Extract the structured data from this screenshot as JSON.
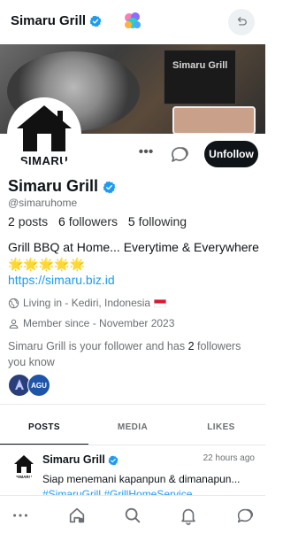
{
  "header": {
    "title": "Simaru Grill",
    "logo_icon": "multicolor-app-logo-icon",
    "back_icon": "undo-arrow-icon"
  },
  "cover": {
    "box_text": "Simaru Grill"
  },
  "profile": {
    "avatar_text": "SIMARU",
    "name": "Simaru Grill",
    "handle": "@simaruhome",
    "unfollow_label": "Unfollow",
    "more_label": "•••",
    "posts_count": "2",
    "posts_label": "posts",
    "followers_count": "6",
    "followers_label": "followers",
    "following_count": "5",
    "following_label": "following",
    "bio": "Grill BBQ at Home... Everytime & Everywhere",
    "bio_emojis": "🌟🌟🌟🌟🌟",
    "link": "https://simaru.biz.id",
    "location": "Living in - Kediri, Indonesia",
    "member_since": "Member since - November 2023",
    "follower_note_prefix": "Simaru Grill is your follower and has",
    "follower_note_count": "2",
    "follower_note_suffix": "followers you know",
    "mini_avatar_b_label": "AGU"
  },
  "tabs": [
    {
      "label": "POSTS"
    },
    {
      "label": "MEDIA"
    },
    {
      "label": "LIKES"
    }
  ],
  "post": {
    "author": "Simaru Grill",
    "time": "22 hours ago",
    "text": "Siap menemani kapanpun & dimanapun...",
    "tags": "#SimaruGrill #GrillHomeService"
  },
  "colors": {
    "accent": "#1d9bf0",
    "primary_button": "#0f1419",
    "flag_red": "#e0142c"
  }
}
